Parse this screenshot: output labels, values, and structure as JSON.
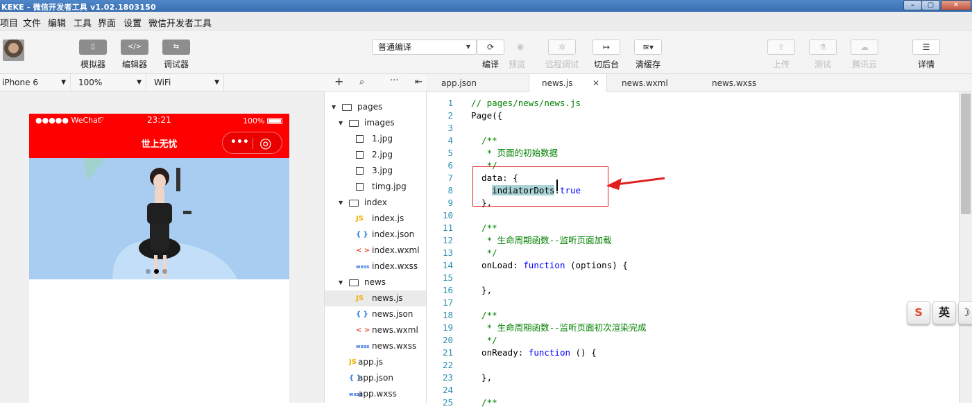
{
  "window": {
    "title": "KEKE - 微信开发者工具 v1.02.1803150",
    "controls": [
      "–",
      "▢",
      "✕"
    ]
  },
  "menubar": [
    "项目",
    "文件",
    "编辑",
    "工具",
    "界面",
    "设置",
    "微信开发者工具"
  ],
  "toolbar": {
    "left_buttons": [
      {
        "label": "模拟器",
        "glyph": "▯"
      },
      {
        "label": "编辑器",
        "glyph": "</>"
      },
      {
        "label": "调试器",
        "glyph": "⇆"
      }
    ],
    "compile_mode": "普通编译",
    "actions": [
      {
        "label": "编译",
        "glyph": "⟳",
        "enabled": true
      },
      {
        "label": "预览",
        "glyph": "◉",
        "enabled": false
      },
      {
        "label": "远程调试",
        "glyph": "✲",
        "enabled": false
      },
      {
        "label": "切后台",
        "glyph": "↦",
        "enabled": true
      },
      {
        "label": "清缓存",
        "glyph": "≋▾",
        "enabled": true
      }
    ],
    "right_actions": [
      {
        "label": "上传",
        "glyph": "⇪",
        "enabled": false
      },
      {
        "label": "测试",
        "glyph": "⚗",
        "enabled": false
      },
      {
        "label": "腾讯云",
        "glyph": "☁",
        "enabled": false
      },
      {
        "label": "详情",
        "glyph": "☰",
        "enabled": true
      }
    ]
  },
  "simulator_bar": {
    "device": "iPhone 6",
    "zoom": "100%",
    "network": "WiFi"
  },
  "phone": {
    "status_carrier": "●●●●● WeChat",
    "wifi_glyph": "⌔",
    "status_time": "23:21",
    "status_battery": "100%",
    "nav_title": "世上无忧",
    "capsule_more": "•••",
    "capsule_close": "◎",
    "banner_color": "#a8cdf0",
    "dots_count": 3,
    "active_dot": 1
  },
  "filetree_bar": [
    "+",
    "⌕",
    "···",
    "⇤"
  ],
  "filetree": [
    {
      "name": "pages",
      "type": "folder",
      "depth": 0,
      "expanded": true
    },
    {
      "name": "images",
      "type": "folder",
      "depth": 1,
      "expanded": true
    },
    {
      "name": "1.jpg",
      "type": "img",
      "depth": 2
    },
    {
      "name": "2.jpg",
      "type": "img",
      "depth": 2
    },
    {
      "name": "3.jpg",
      "type": "img",
      "depth": 2
    },
    {
      "name": "timg.jpg",
      "type": "img",
      "depth": 2
    },
    {
      "name": "index",
      "type": "folder",
      "depth": 1,
      "expanded": true
    },
    {
      "name": "index.js",
      "type": "js",
      "depth": 2
    },
    {
      "name": "index.json",
      "type": "json",
      "depth": 2
    },
    {
      "name": "index.wxml",
      "type": "wxml",
      "depth": 2
    },
    {
      "name": "index.wxss",
      "type": "wxss",
      "depth": 2
    },
    {
      "name": "news",
      "type": "folder",
      "depth": 1,
      "expanded": true
    },
    {
      "name": "news.js",
      "type": "js",
      "depth": 2,
      "selected": true
    },
    {
      "name": "news.json",
      "type": "json",
      "depth": 2
    },
    {
      "name": "news.wxml",
      "type": "wxml",
      "depth": 2
    },
    {
      "name": "news.wxss",
      "type": "wxss",
      "depth": 2
    },
    {
      "name": "app.js",
      "type": "js",
      "depth": 1
    },
    {
      "name": "app.json",
      "type": "json",
      "depth": 1
    },
    {
      "name": "app.wxss",
      "type": "wxss",
      "depth": 1
    }
  ],
  "icon_labels": {
    "js": "JS",
    "json": "{ }",
    "wxml": "< >",
    "wxss": "wxss"
  },
  "tabs": [
    {
      "label": "app.json",
      "active": false
    },
    {
      "label": "news.js",
      "active": true,
      "close": "✕"
    },
    {
      "label": "news.wxml",
      "active": false
    },
    {
      "label": "news.wxss",
      "active": false
    }
  ],
  "code_lines": [
    {
      "n": "1",
      "parts": [
        [
          "cm",
          "// pages/news/news.js"
        ]
      ]
    },
    {
      "n": "2",
      "parts": [
        [
          "",
          "Page({"
        ]
      ]
    },
    {
      "n": "3",
      "parts": []
    },
    {
      "n": "4",
      "parts": [
        [
          "cm",
          "  /**"
        ]
      ]
    },
    {
      "n": "5",
      "parts": [
        [
          "cm",
          "   * 页面的初始数据"
        ]
      ]
    },
    {
      "n": "6",
      "parts": [
        [
          "cm",
          "   */"
        ]
      ]
    },
    {
      "n": "7",
      "parts": [
        [
          "",
          "  data: {"
        ]
      ]
    },
    {
      "n": "8",
      "parts": [
        [
          "",
          "    "
        ],
        [
          "hl",
          "indiatorDots"
        ],
        [
          "",
          ":"
        ],
        [
          "kw",
          "true"
        ]
      ]
    },
    {
      "n": "9",
      "parts": [
        [
          "",
          "  },"
        ]
      ]
    },
    {
      "n": "10",
      "parts": []
    },
    {
      "n": "11",
      "parts": [
        [
          "cm",
          "  /**"
        ]
      ]
    },
    {
      "n": "12",
      "parts": [
        [
          "cm",
          "   * 生命周期函数--监听页面加载"
        ]
      ]
    },
    {
      "n": "13",
      "parts": [
        [
          "cm",
          "   */"
        ]
      ]
    },
    {
      "n": "14",
      "parts": [
        [
          "",
          "  onLoad: "
        ],
        [
          "kw",
          "function"
        ],
        [
          "",
          " (options) {"
        ]
      ]
    },
    {
      "n": "15",
      "parts": []
    },
    {
      "n": "16",
      "parts": [
        [
          "",
          "  },"
        ]
      ]
    },
    {
      "n": "17",
      "parts": []
    },
    {
      "n": "18",
      "parts": [
        [
          "cm",
          "  /**"
        ]
      ]
    },
    {
      "n": "19",
      "parts": [
        [
          "cm",
          "   * 生命周期函数--监听页面初次渲染完成"
        ]
      ]
    },
    {
      "n": "20",
      "parts": [
        [
          "cm",
          "   */"
        ]
      ]
    },
    {
      "n": "21",
      "parts": [
        [
          "",
          "  onReady: "
        ],
        [
          "kw",
          "function"
        ],
        [
          "",
          " () {"
        ]
      ]
    },
    {
      "n": "22",
      "parts": []
    },
    {
      "n": "23",
      "parts": [
        [
          "",
          "  },"
        ]
      ]
    },
    {
      "n": "24",
      "parts": []
    },
    {
      "n": "25",
      "parts": [
        [
          "cm",
          "  /**"
        ]
      ]
    }
  ],
  "ime": [
    "S",
    "英",
    "☽"
  ],
  "colors": {
    "nav_red": "#ff0000",
    "annotation_red": "#e02020",
    "comment_green": "#008000",
    "keyword_blue": "#0000ff",
    "line_number": "#2b91af",
    "highlight": "#a9d3d6"
  }
}
